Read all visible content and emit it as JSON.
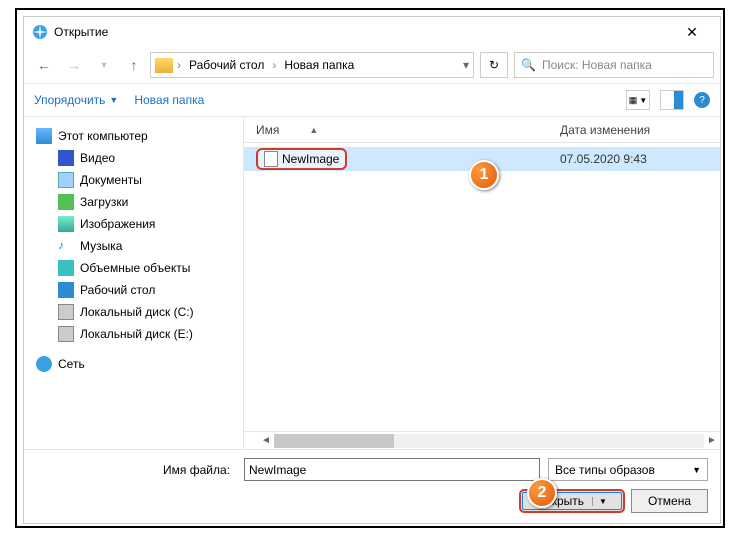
{
  "window": {
    "title": "Открытие"
  },
  "breadcrumb": {
    "seg1": "Рабочий стол",
    "seg2": "Новая папка"
  },
  "search": {
    "placeholder": "Поиск: Новая папка"
  },
  "toolbar": {
    "organize": "Упорядочить",
    "newfolder": "Новая папка"
  },
  "columns": {
    "name": "Имя",
    "date": "Дата изменения"
  },
  "tree": {
    "pc": "Этот компьютер",
    "video": "Видео",
    "docs": "Документы",
    "downloads": "Загрузки",
    "images": "Изображения",
    "music": "Музыка",
    "obj3d": "Объемные объекты",
    "desktop": "Рабочий стол",
    "diskC": "Локальный диск (C:)",
    "diskE": "Локальный диск (E:)",
    "network": "Сеть"
  },
  "file": {
    "name": "NewImage",
    "date": "07.05.2020 9:43"
  },
  "footer": {
    "fname_label": "Имя файла:",
    "fname_value": "NewImage",
    "filter": "Все типы образов",
    "open": "Открыть",
    "cancel": "Отмена"
  },
  "markers": {
    "one": "1",
    "two": "2"
  }
}
